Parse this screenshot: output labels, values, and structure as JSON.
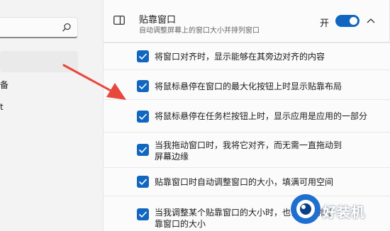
{
  "sidebar": {
    "search_placeholder": "",
    "items": [
      {
        "label": "备"
      },
      {
        "label": "t"
      }
    ]
  },
  "snap": {
    "icon": "snap-window-icon",
    "title": "贴靠窗口",
    "subtitle": "自动调整屏幕上的窗口大小并排列窗口",
    "toggle_label": "开",
    "toggle_state": "on",
    "expanded": true
  },
  "options": [
    {
      "label": "将窗口对齐时，显示能够在其旁边对齐的内容",
      "checked": true
    },
    {
      "label": "将鼠标悬停在窗口的最大化按钮上时显示贴靠布局",
      "checked": true
    },
    {
      "label": "将鼠标悬停在任务栏按钮上时，显示应用是应用的一部分",
      "checked": true
    },
    {
      "label": "当我拖动窗口时，我将它对齐，而无需一直拖动到屏幕边缘",
      "checked": true
    },
    {
      "label": "贴靠窗口时自动调整窗口的大小，填满可用空间",
      "checked": true
    },
    {
      "label": "当我调整某个贴靠窗口的大小时，也调整相邻贴靠窗口的大小",
      "checked": true
    }
  ],
  "watermark": {
    "text": "好装机"
  },
  "colors": {
    "accent": "#1166c0",
    "arrow": "#e8473c"
  }
}
